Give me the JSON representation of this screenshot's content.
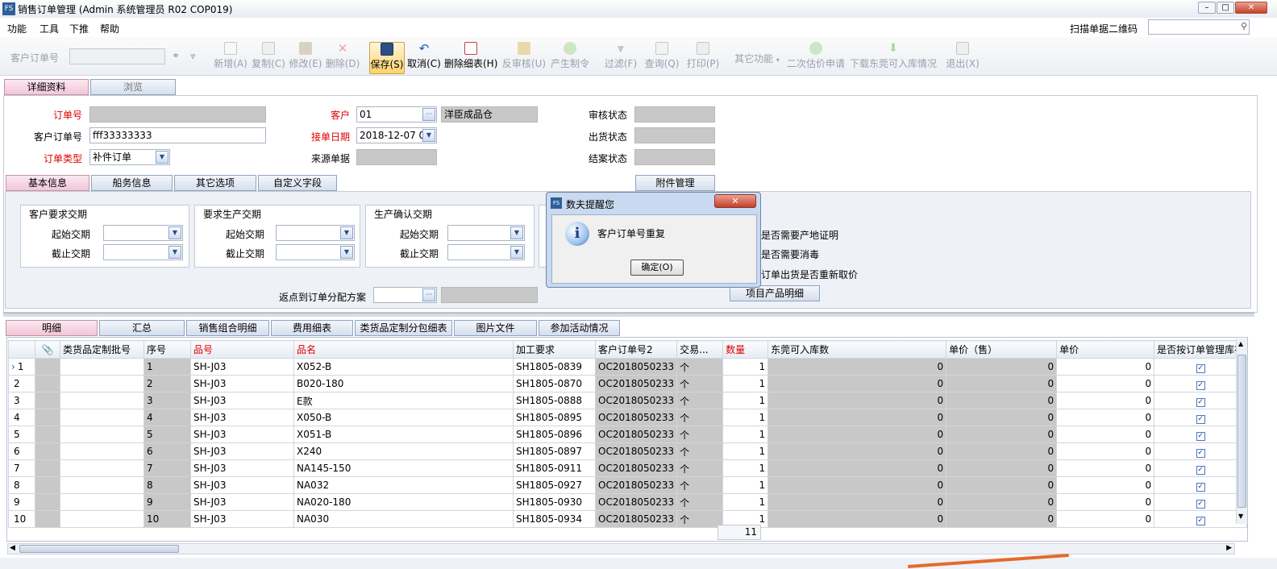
{
  "window": {
    "title": "销售订单管理 (Admin 系统管理员 R02 COP019)",
    "controls": [
      "–",
      "□",
      "✕"
    ]
  },
  "menu": [
    "功能",
    "工具",
    "下推",
    "帮助"
  ],
  "scan_label": "扫描单据二维码",
  "toolbar": {
    "customer_order_label": "客户订单号",
    "buttons": [
      "新增(A)",
      "复制(C)",
      "修改(E)",
      "删除(D)",
      "保存(S)",
      "取消(C)",
      "删除细表(H)",
      "反审核(U)",
      "产生制令",
      "过滤(F)",
      "查询(Q)",
      "打印(P)",
      "其它功能",
      "二次估价申请",
      "下载东莞可入库情况",
      "退出(X)"
    ]
  },
  "main_tabs": [
    "详细资料",
    "浏览"
  ],
  "form": {
    "order_no_label": "订单号",
    "order_no_value": "",
    "customer_label": "客户",
    "customer_value": "01",
    "customer_name": "洋臣成品仓",
    "audit_label": "审核状态",
    "audit_value": "",
    "cust_order_label": "客户订单号",
    "cust_order_value": "fff33333333",
    "receive_date_label": "接单日期",
    "receive_date_value": "2018-12-07 0",
    "ship_label": "出货状态",
    "ship_value": "",
    "order_type_label": "订单类型",
    "order_type_value": "补件订单",
    "source_label": "来源单据",
    "source_value": "",
    "close_label": "结案状态",
    "close_value": ""
  },
  "sub_tabs": [
    "基本信息",
    "船务信息",
    "其它选项",
    "自定义字段"
  ],
  "attach_button": "附件管理",
  "groups": [
    {
      "title": "客户要求交期",
      "start": "起始交期",
      "end": "截止交期"
    },
    {
      "title": "要求生产交期",
      "start": "起始交期",
      "end": "截止交期"
    },
    {
      "title": "生产确认交期",
      "start": "起始交期",
      "end": "截止交期"
    }
  ],
  "checks": [
    "是否需要产地证明",
    "是否需要消毒",
    "订单出货是否重新取价"
  ],
  "rebate_label": "返点到订单分配方案",
  "project_button": "项目产品明细",
  "detail_tabs": [
    "明细",
    "汇总",
    "销售组合明细",
    "费用细表",
    "类货品定制分包细表",
    "图片文件",
    "参加活动情况"
  ],
  "grid": {
    "headers": [
      "",
      "📎",
      "类货品定制批号",
      "序号",
      "品号",
      "品名",
      "加工要求",
      "客户订单号2",
      "交易...",
      "数量",
      "东莞可入库数",
      "单价（售）",
      "单价",
      "是否按订单管理库存"
    ],
    "rows": [
      [
        "1",
        "1",
        "SH-J03",
        "X052-B",
        "SH1805-0839",
        "OC2018050233",
        "个",
        "1",
        "0",
        "0",
        "0"
      ],
      [
        "2",
        "2",
        "SH-J03",
        "B020-180",
        "SH1805-0870",
        "OC2018050233",
        "个",
        "1",
        "0",
        "0",
        "0"
      ],
      [
        "3",
        "3",
        "SH-J03",
        "E款",
        "SH1805-0888",
        "OC2018050233",
        "个",
        "1",
        "0",
        "0",
        "0"
      ],
      [
        "4",
        "4",
        "SH-J03",
        "X050-B",
        "SH1805-0895",
        "OC2018050233",
        "个",
        "1",
        "0",
        "0",
        "0"
      ],
      [
        "5",
        "5",
        "SH-J03",
        "X051-B",
        "SH1805-0896",
        "OC2018050233",
        "个",
        "1",
        "0",
        "0",
        "0"
      ],
      [
        "6",
        "6",
        "SH-J03",
        "X240",
        "SH1805-0897",
        "OC2018050233",
        "个",
        "1",
        "0",
        "0",
        "0"
      ],
      [
        "7",
        "7",
        "SH-J03",
        "NA145-150",
        "SH1805-0911",
        "OC2018050233",
        "个",
        "1",
        "0",
        "0",
        "0"
      ],
      [
        "8",
        "8",
        "SH-J03",
        "NA032",
        "SH1805-0927",
        "OC2018050233",
        "个",
        "1",
        "0",
        "0",
        "0"
      ],
      [
        "9",
        "9",
        "SH-J03",
        "NA020-180",
        "SH1805-0930",
        "OC2018050233",
        "个",
        "1",
        "0",
        "0",
        "0"
      ],
      [
        "10",
        "10",
        "SH-J03",
        "NA030",
        "SH1805-0934",
        "OC2018050233",
        "个",
        "1",
        "0",
        "0",
        "0"
      ]
    ],
    "total": "11"
  },
  "dialog": {
    "title": "数夫提醒您",
    "message": "客户订单号重复",
    "ok": "确定(O)"
  }
}
